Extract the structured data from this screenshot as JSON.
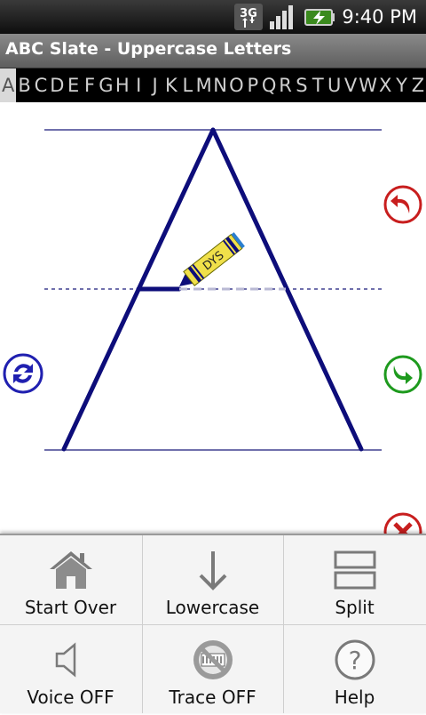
{
  "status": {
    "network": "3G",
    "time": "9:40 PM"
  },
  "app": {
    "title": "ABC Slate - Uppercase Letters"
  },
  "letters": [
    "A",
    "B",
    "C",
    "D",
    "E",
    "F",
    "G",
    "H",
    "I",
    "J",
    "K",
    "L",
    "M",
    "N",
    "O",
    "P",
    "Q",
    "R",
    "S",
    "T",
    "U",
    "V",
    "W",
    "X",
    "Y",
    "Z"
  ],
  "selected_letter": "A",
  "crayon": {
    "label": "DYS",
    "color": "#f0e04a"
  },
  "colors": {
    "stroke": "#0d0d7a",
    "undo": "#c81e1e",
    "redo": "#1e9a1e",
    "refresh": "#2020b0"
  },
  "menu": {
    "start_over": "Start Over",
    "lowercase": "Lowercase",
    "split": "Split",
    "voice": "Voice OFF",
    "trace": "Trace OFF",
    "help": "Help"
  }
}
